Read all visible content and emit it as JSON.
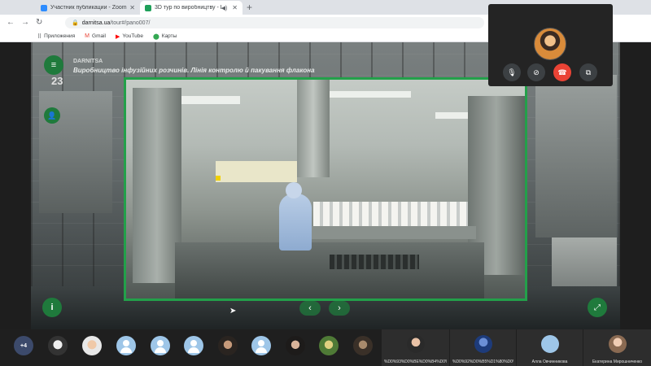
{
  "browser": {
    "tabs": [
      {
        "title": "Участник публикации - Zoom",
        "favicon_color": "#2d8cff"
      },
      {
        "title": "3D тур по виробництву - D",
        "favicon_color": "#1fa05a"
      }
    ],
    "new_tab_symbol": "+",
    "url_host": "darnitsa.ua",
    "url_path": "/tour#/pano007/",
    "bookmarks": [
      {
        "label": "Приложения",
        "icon": "apps-grid-icon"
      },
      {
        "label": "Gmail",
        "icon": "gmail-icon"
      },
      {
        "label": "YouTube",
        "icon": "youtube-icon"
      },
      {
        "label": "Карты",
        "icon": "maps-icon"
      }
    ]
  },
  "tour": {
    "brand": "DARNITSA",
    "headline": "Виробництво інфузійних розчинів. Лінія контролю й пакування флакона",
    "scene_counter": "23",
    "accent_color": "#1f7a3c",
    "panel_border_color": "#23a04a"
  },
  "zoom": {
    "self_view_controls": [
      "mic-icon",
      "camera-off-icon",
      "end-call-icon",
      "switch-layout-icon"
    ],
    "participant_overflow": "+4",
    "named_participants": [
      {
        "label": "%D0%93%D0%BE%D0%B4%D0%B8%D0%B4..."
      },
      {
        "label": "%D0%92%D0%B5%D1%80%D0%BE%D0%BD..."
      },
      {
        "label": "Алла Овчинникова"
      },
      {
        "label": "Екатерина Мирошниченко"
      }
    ]
  }
}
